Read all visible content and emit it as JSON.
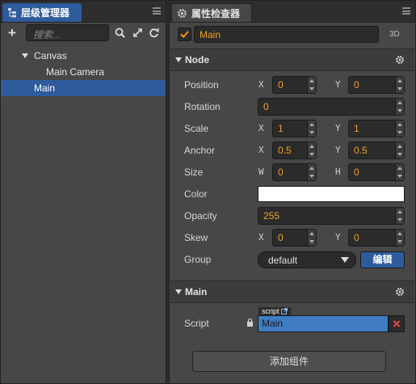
{
  "hierarchy": {
    "tab_title": "层级管理器",
    "search_placeholder": "搜索...",
    "tree": [
      {
        "label": "Canvas",
        "expanded": true
      },
      {
        "label": "Main Camera"
      },
      {
        "label": "Main",
        "selected": true
      }
    ]
  },
  "inspector": {
    "tab_title": "属性检查器",
    "node_name": "Main",
    "mode_label": "3D",
    "node_section_title": "Node",
    "position_label": "Position",
    "position_x": "0",
    "position_y": "0",
    "rotation_label": "Rotation",
    "rotation": "0",
    "scale_label": "Scale",
    "scale_x": "1",
    "scale_y": "1",
    "anchor_label": "Anchor",
    "anchor_x": "0.5",
    "anchor_y": "0.5",
    "size_label": "Size",
    "size_w": "0",
    "size_h": "0",
    "color_label": "Color",
    "color_value": "#ffffff",
    "opacity_label": "Opacity",
    "opacity": "255",
    "skew_label": "Skew",
    "skew_x": "0",
    "skew_y": "0",
    "group_label": "Group",
    "group_value": "default",
    "edit_button": "编辑",
    "axis": {
      "x": "X",
      "y": "Y",
      "w": "W",
      "h": "H"
    },
    "script_section_title": "Main",
    "script_label": "Script",
    "script_tag": "script",
    "script_value": "Main",
    "add_component_button": "添加组件"
  },
  "colors": {
    "accent": "#2d5b9c",
    "value_text": "#f0a02a",
    "checkbox": "#e8821e"
  }
}
